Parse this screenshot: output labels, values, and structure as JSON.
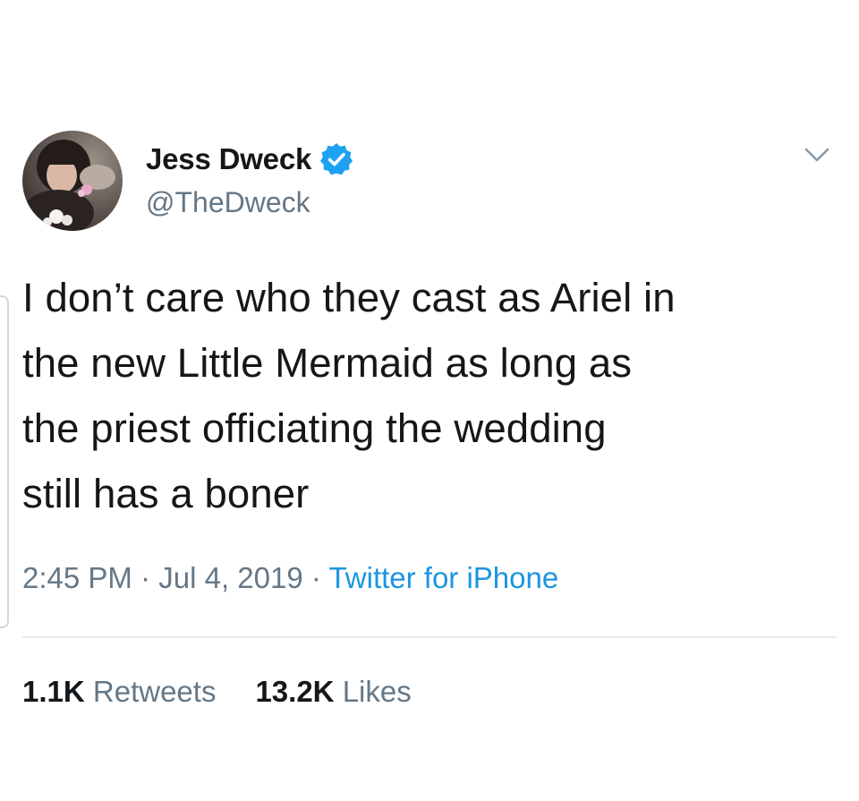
{
  "tweet": {
    "author": {
      "display_name": "Jess Dweck",
      "handle": "@TheDweck",
      "verified": true
    },
    "text": "I don’t care who they cast as Ariel in\nthe new Little Mermaid as long as\nthe priest officiating the wedding\nstill has a boner",
    "meta": {
      "time": "2:45 PM",
      "separator": " · ",
      "date": "Jul 4, 2019",
      "source": "Twitter for iPhone"
    },
    "stats": {
      "retweets_count": "1.1K",
      "retweets_label": "Retweets",
      "likes_count": "13.2K",
      "likes_label": "Likes"
    }
  },
  "icons": {
    "verified": "verified-badge-icon",
    "menu": "chevron-down-icon"
  },
  "colors": {
    "text": "#14171a",
    "secondary": "#657786",
    "link": "#1b95e0",
    "verified": "#1da1f2",
    "divider": "#e6ecf0"
  }
}
